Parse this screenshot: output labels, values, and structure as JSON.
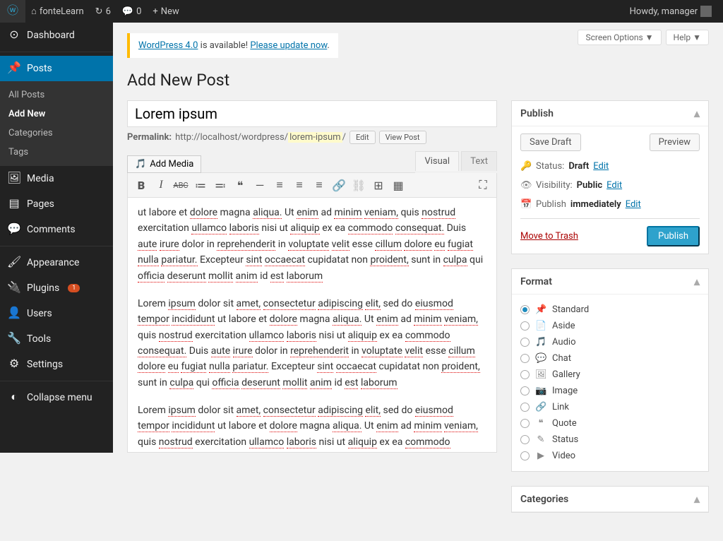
{
  "adminbar": {
    "site": "fonteLearn",
    "updates": "6",
    "comments": "0",
    "new": "New",
    "greeting": "Howdy, manager"
  },
  "sidebar": {
    "dashboard": "Dashboard",
    "posts": "Posts",
    "submenu": {
      "all": "All Posts",
      "add": "Add New",
      "categories": "Categories",
      "tags": "Tags"
    },
    "media": "Media",
    "pages": "Pages",
    "comments": "Comments",
    "appearance": "Appearance",
    "plugins": "Plugins",
    "plugin_count": "1",
    "users": "Users",
    "tools": "Tools",
    "settings": "Settings",
    "collapse": "Collapse menu"
  },
  "topbuttons": {
    "screen_options": "Screen Options",
    "help": "Help"
  },
  "update_nag": {
    "prefix": "WordPress 4.0",
    "text": " is available! ",
    "link": "Please update now"
  },
  "page_title": "Add New Post",
  "post": {
    "title": "Lorem ipsum",
    "permalink_label": "Permalink:",
    "permalink_base": "http://localhost/wordpress/",
    "slug": "lorem-ipsum",
    "edit_btn": "Edit",
    "view_btn": "View Post",
    "add_media": "Add Media"
  },
  "editor": {
    "visual_tab": "Visual",
    "text_tab": "Text",
    "body": "ut labore et dolore magna aliqua. Ut enim ad minim veniam, quis nostrud exercitation ullamco laboris nisi ut aliquip ex ea commodo consequat. Duis aute irure dolor in reprehenderit in voluptate velit esse cillum dolore eu fugiat nulla pariatur. Excepteur sint occaecat cupidatat non proident, sunt in culpa qui officia deserunt mollit anim id est laborum\n\nLorem ipsum dolor sit amet, consectetur adipiscing elit, sed do eiusmod tempor incididunt ut labore et dolore magna aliqua. Ut enim ad minim veniam, quis nostrud exercitation ullamco laboris nisi ut aliquip ex ea commodo consequat. Duis aute irure dolor in reprehenderit in voluptate velit esse cillum dolore eu fugiat nulla pariatur. Excepteur sint occaecat cupidatat non proident, sunt in culpa qui officia deserunt mollit anim id est laborum\n\nLorem ipsum dolor sit amet, consectetur adipiscing elit, sed do eiusmod tempor incididunt ut labore et dolore magna aliqua. Ut enim ad minim veniam, quis nostrud exercitation ullamco laboris nisi ut aliquip ex ea commodo consequat. Duis aute irure dolor in reprehenderit in voluptate velit esse cillum dolore eu fugiat nulla pariatur. Excepteur sint occaecat cupidatat non proident, sunt in culpa qui officia deserunt mollit anim id est laborum"
  },
  "publish": {
    "title": "Publish",
    "save_draft": "Save Draft",
    "preview": "Preview",
    "status_label": "Status:",
    "status_value": "Draft",
    "visibility_label": "Visibility:",
    "visibility_value": "Public",
    "schedule_label": "Publish",
    "schedule_value": "immediately",
    "edit": "Edit",
    "trash": "Move to Trash",
    "publish_btn": "Publish"
  },
  "format": {
    "title": "Format",
    "items": [
      {
        "id": "standard",
        "label": "Standard",
        "icon": "📌",
        "selected": true
      },
      {
        "id": "aside",
        "label": "Aside",
        "icon": "📄",
        "selected": false
      },
      {
        "id": "audio",
        "label": "Audio",
        "icon": "🎵",
        "selected": false
      },
      {
        "id": "chat",
        "label": "Chat",
        "icon": "💬",
        "selected": false
      },
      {
        "id": "gallery",
        "label": "Gallery",
        "icon": "🖼",
        "selected": false
      },
      {
        "id": "image",
        "label": "Image",
        "icon": "📷",
        "selected": false
      },
      {
        "id": "link",
        "label": "Link",
        "icon": "🔗",
        "selected": false
      },
      {
        "id": "quote",
        "label": "Quote",
        "icon": "❝",
        "selected": false
      },
      {
        "id": "status",
        "label": "Status",
        "icon": "✎",
        "selected": false
      },
      {
        "id": "video",
        "label": "Video",
        "icon": "▶",
        "selected": false
      }
    ]
  },
  "categories": {
    "title": "Categories"
  }
}
